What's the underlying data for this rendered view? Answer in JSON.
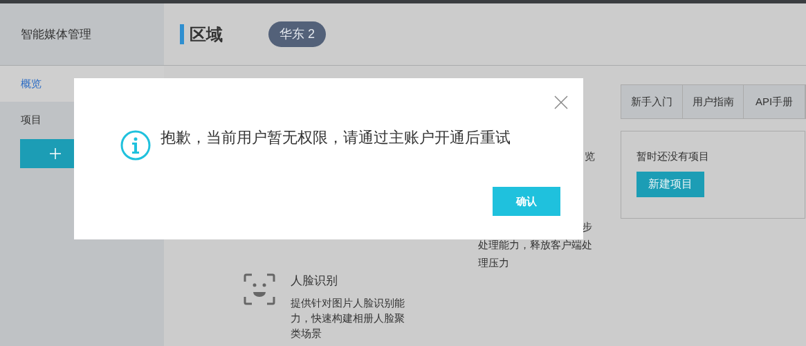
{
  "sidebar": {
    "title": "智能媒体管理",
    "items": [
      {
        "label": "概览",
        "selected": true
      },
      {
        "label": "项目",
        "selected": false
      }
    ]
  },
  "header": {
    "title": "区域",
    "region": "华东 2"
  },
  "help_links": [
    "新手入门",
    "用户指南",
    "API手册"
  ],
  "projects_card": {
    "empty_text": "暂时还没有项目",
    "create_button": "新建项目"
  },
  "features": [
    {
      "lines": [
        "览"
      ]
    },
    {
      "lines": [
        "步",
        "处理能力，释放客户端处",
        "理压力"
      ]
    },
    {
      "title": "人脸识别",
      "lines": [
        "提供针对图片人脸识别能",
        "力，快速构建相册人脸聚",
        "类场景"
      ]
    }
  ],
  "dialog": {
    "message": "抱歉，当前用户暂无权限，请通过主账户开通后重试",
    "confirm": "确认"
  }
}
